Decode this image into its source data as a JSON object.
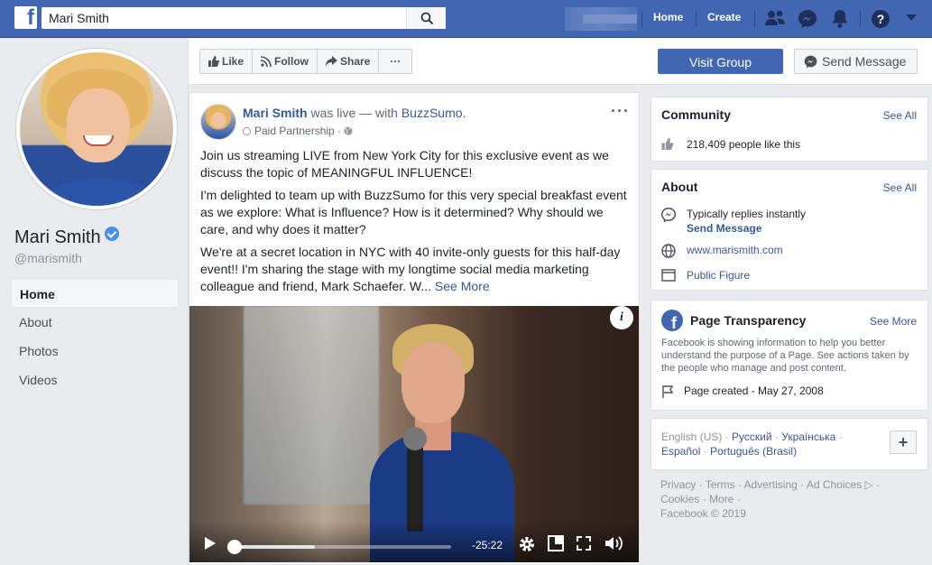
{
  "topbar": {
    "search_value": "Mari Smith",
    "nav": [
      "Home",
      "Create"
    ]
  },
  "profile": {
    "name": "Mari Smith",
    "handle": "@marismith",
    "left_nav": [
      "Home",
      "About",
      "Photos",
      "Videos"
    ],
    "active_nav": "Home"
  },
  "actions": {
    "like": "Like",
    "follow": "Follow",
    "share": "Share",
    "more": "···",
    "visit": "Visit Group",
    "send": "Send Message"
  },
  "post": {
    "author": "Mari Smith",
    "verb": " was live — with ",
    "with": "BuzzSumo.",
    "sub": "Paid Partnership",
    "p1": "Join us streaming LIVE from New York City for this exclusive event as we discuss the topic of MEANINGFUL INFLUENCE!",
    "p2": "I'm delighted to team up with BuzzSumo for this very special breakfast event as we explore: What is Influence? How is it determined? Why should we care, and why does it matter?",
    "p3": "We're at a secret location in NYC with 40 invite-only guests for this half-day event!! I'm sharing the stage with my longtime social media marketing colleague and friend, Mark Schaefer. W...",
    "see_more": "See More",
    "video_time": "-25:22",
    "video_progress": 0.37
  },
  "community": {
    "title": "Community",
    "see_all": "See All",
    "likes": "218,409 people like this"
  },
  "about": {
    "title": "About",
    "see_all": "See All",
    "replies": "Typically replies instantly",
    "send_message": "Send Message",
    "website": "www.marismith.com",
    "category": "Public Figure"
  },
  "transparency": {
    "title": "Page Transparency",
    "see_more": "See More",
    "desc": "Facebook is showing information to help you better understand the purpose of a Page. See actions taken by the people who manage and post content.",
    "created": "Page created - May 27, 2008"
  },
  "languages": {
    "current": "English (US)",
    "l1": "Русский",
    "l2": "Українська",
    "l3": "Español",
    "l4": "Português (Brasil)"
  },
  "footer": {
    "line1": "Privacy · Terms · Advertising · Ad Choices ▷ ·",
    "line2": "Cookies · More ·",
    "line3": "Facebook © 2019"
  }
}
